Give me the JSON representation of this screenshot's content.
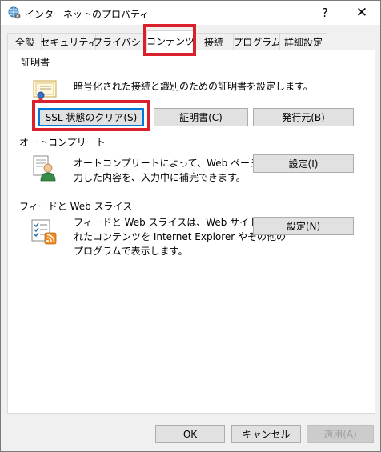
{
  "window": {
    "title": "インターネットのプロパティ",
    "help_label": "?",
    "close_label": "✕",
    "icon": "globe-settings-icon"
  },
  "tabs": [
    {
      "label": "全般"
    },
    {
      "label": "セキュリティ"
    },
    {
      "label": "プライバシー"
    },
    {
      "label": "コンテンツ",
      "active": true
    },
    {
      "label": "接続"
    },
    {
      "label": "プログラム"
    },
    {
      "label": "詳細設定"
    }
  ],
  "certificates": {
    "header": "証明書",
    "description": "暗号化された接続と識別のための証明書を設定します。",
    "icon": "certificate-icon",
    "clear_ssl_label": "SSL 状態のクリア(S)",
    "certificates_label": "証明書(C)",
    "publishers_label": "発行元(B)"
  },
  "autocomplete": {
    "header": "オートコンプリート",
    "description_line1": "オートコンプリートによって、Web ページで前回入",
    "description_line2": "力した内容を、入力中に補完できます。",
    "icon": "user-form-icon",
    "settings_label": "設定(I)"
  },
  "feeds": {
    "header": "フィードと Web スライス",
    "description_line1": "フィードと Web スライスは、Web サイトの更新さ",
    "description_line2": "れたコンテンツを Internet Explorer やその他の",
    "description_line3": "プログラムで表示します。",
    "icon": "feed-checklist-icon",
    "settings_label": "設定(N)"
  },
  "footer": {
    "ok_label": "OK",
    "cancel_label": "キャンセル",
    "apply_label": "適用(A)"
  },
  "colors": {
    "highlight": "#d9202b",
    "focus": "#0078d7",
    "feed_orange": "#f08a24"
  }
}
